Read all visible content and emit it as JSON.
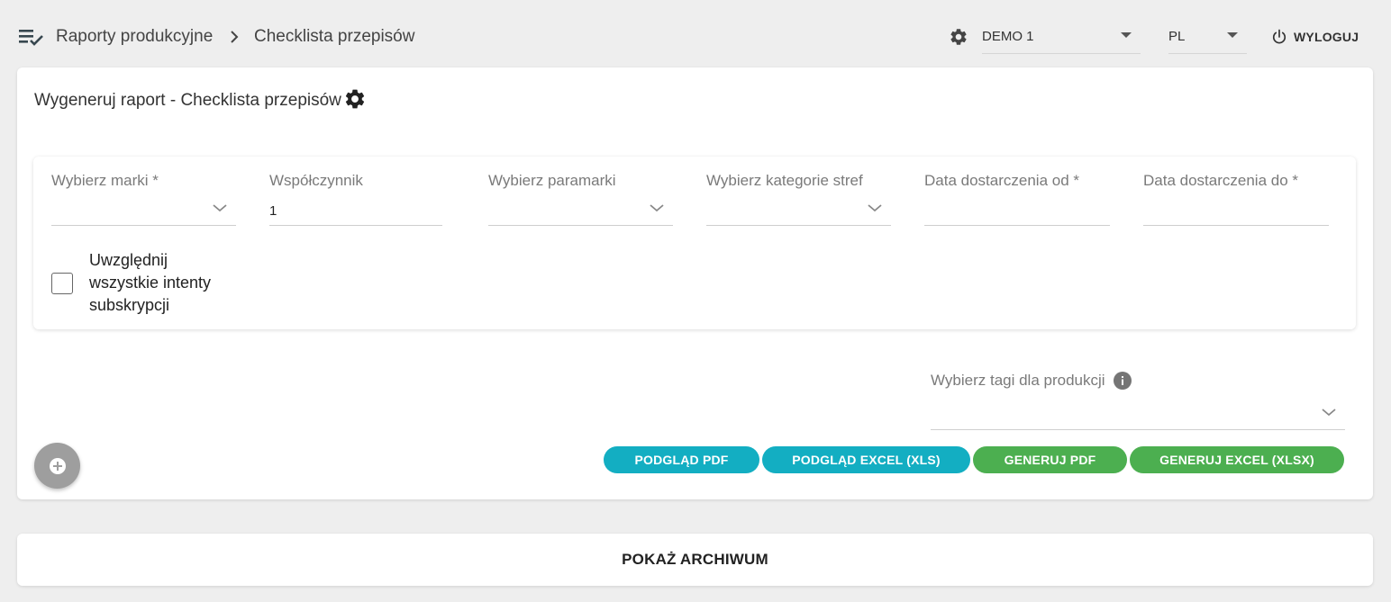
{
  "header": {
    "breadcrumb": [
      "Raporty produkcyjne",
      "Checklista przepisów"
    ],
    "account_select": "DEMO 1",
    "language_select": "PL",
    "logout_label": "WYLOGUJ"
  },
  "report": {
    "title": "Wygeneruj raport - Checklista przepisów",
    "filters": {
      "brands_label": "Wybierz marki *",
      "coefficient_label": "Współczynnik",
      "coefficient_value": "1",
      "parabrands_label": "Wybierz paramarki",
      "zone_categories_label": "Wybierz kategorie stref",
      "delivery_from_label": "Data dostarczenia od *",
      "delivery_to_label": "Data dostarczenia do *",
      "include_all_intents_label": "Uwzględnij wszystkie intenty subskrypcji",
      "include_all_intents_checked": false
    },
    "tags_label": "Wybierz tagi dla produkcji",
    "buttons": {
      "preview_pdf": "PODGLĄD PDF",
      "preview_excel": "PODGLĄD EXCEL (XLS)",
      "generate_pdf": "GENERUJ PDF",
      "generate_excel": "GENERUJ EXCEL (XLSX)"
    }
  },
  "archive": {
    "label": "POKAŻ ARCHIWUM"
  },
  "colors": {
    "background": "#eeeeee",
    "teal_button": "#13aec2",
    "green_button": "#4caf50",
    "fab": "#9e9e9e"
  },
  "icons": {
    "menu": "playlist-check-icon",
    "breadcrumb_sep": "chevron-right-icon",
    "settings": "gear-icon",
    "logout": "power-icon",
    "info": "info-icon",
    "add": "add-circle-icon"
  }
}
